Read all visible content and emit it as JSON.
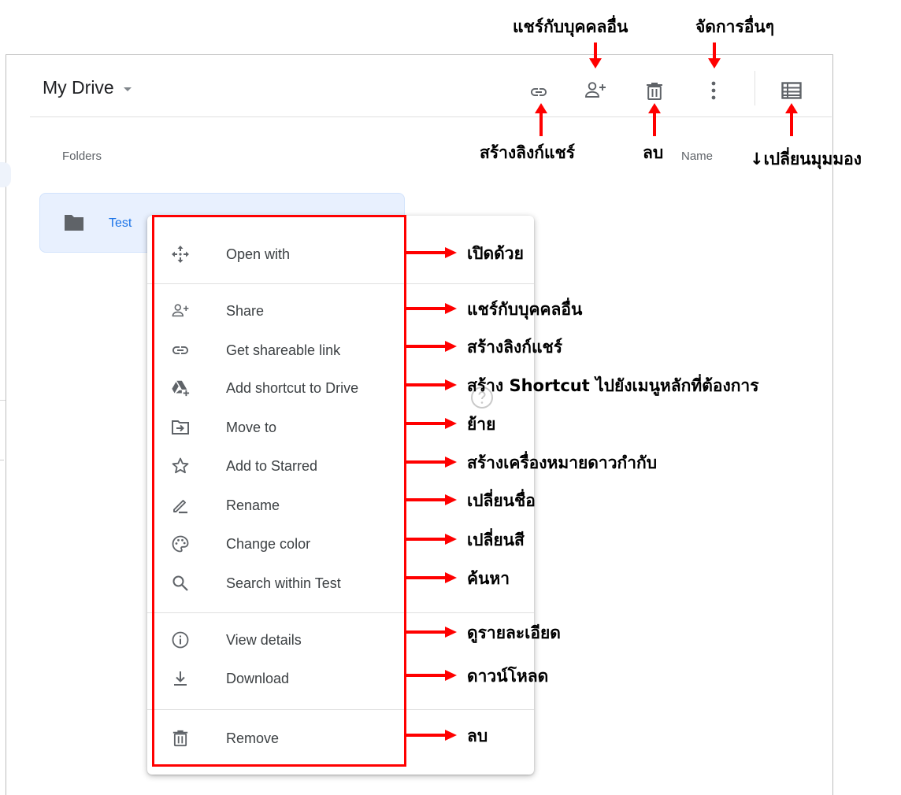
{
  "header": {
    "title": "My Drive",
    "toolbar": {
      "link_icon": "link-icon",
      "share_icon": "person-add-icon",
      "delete_icon": "trash-icon",
      "more_icon": "more-vert-icon",
      "view_icon": "list-view-icon"
    }
  },
  "content": {
    "folders_label": "Folders",
    "sort_label": "Name",
    "folder": {
      "name": "Test",
      "icon": "folder-icon"
    }
  },
  "context_menu": {
    "items": [
      {
        "label": "Open with",
        "icon": "open-with-icon"
      },
      {
        "label": "Share",
        "icon": "person-add-icon"
      },
      {
        "label": "Get shareable link",
        "icon": "link-icon"
      },
      {
        "label": "Add shortcut to Drive",
        "icon": "drive-shortcut-icon"
      },
      {
        "label": "Move to",
        "icon": "move-folder-icon"
      },
      {
        "label": "Add to Starred",
        "icon": "star-icon"
      },
      {
        "label": "Rename",
        "icon": "pencil-icon"
      },
      {
        "label": "Change color",
        "icon": "palette-icon"
      },
      {
        "label": "Search within Test",
        "icon": "search-icon"
      },
      {
        "label": "View details",
        "icon": "info-icon"
      },
      {
        "label": "Download",
        "icon": "download-icon"
      },
      {
        "label": "Remove",
        "icon": "trash-icon"
      }
    ]
  },
  "annotations": {
    "top_share": "แชร์กับบุคคลอื่น",
    "top_more": "จัดการอื่นๆ",
    "bottom_link": "สร้างลิงก์แชร์",
    "bottom_delete": "ลบ",
    "bottom_view": "↓เปลี่ยนมุมมอง",
    "menu": [
      "เปิดด้วย",
      "แชร์กับบุคคลอื่น",
      "สร้างลิงก์แชร์",
      "สร้าง Shortcut ไปยังเมนูหลักที่ต้องการ",
      "ย้าย",
      "สร้างเครื่องหมายดาวกำกับ",
      "เปลี่ยนชื่อ",
      "เปลี่ยนสี",
      "ค้นหา",
      "ดูรายละเอียด",
      "ดาวน์โหลด",
      "ลบ"
    ]
  },
  "colors": {
    "accent": "#1a73e8",
    "folder_bg": "#e8f0fe",
    "icon": "#5f6368",
    "annotation_red": "#ff0000"
  }
}
